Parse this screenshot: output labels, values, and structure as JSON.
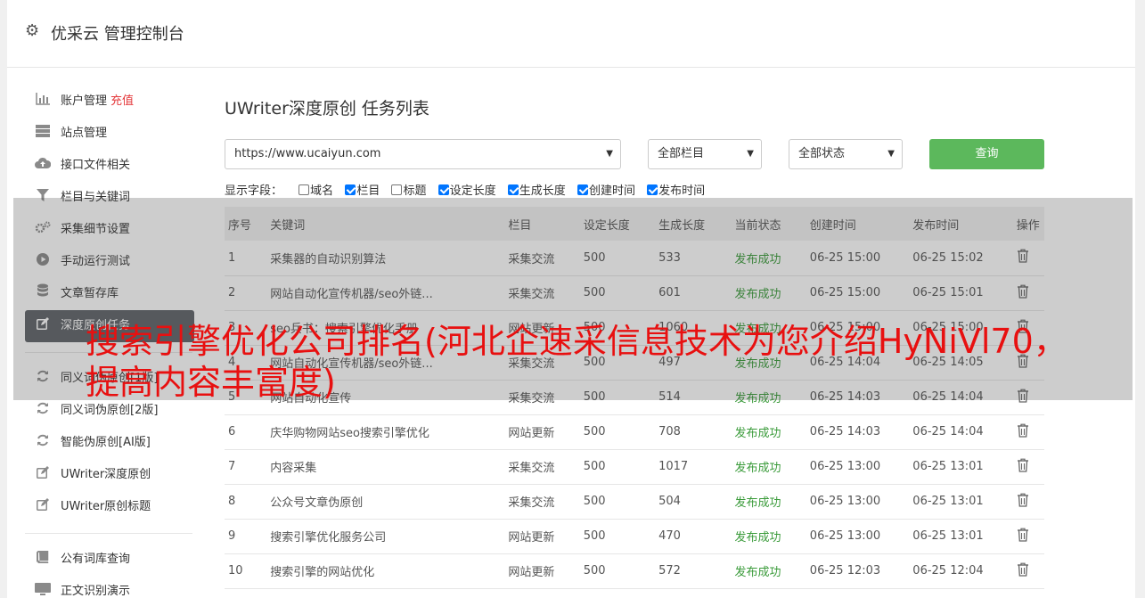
{
  "header": {
    "title": "优采云 管理控制台",
    "icon": "gear-icon"
  },
  "sidebar": {
    "items": [
      {
        "label": "账户管理",
        "badge": "充值",
        "icon": "bar-chart-icon"
      },
      {
        "label": "站点管理",
        "icon": "server-icon"
      },
      {
        "label": "接口文件相关",
        "icon": "cloud-upload-icon"
      },
      {
        "label": "栏目与关键词",
        "icon": "filter-icon"
      },
      {
        "label": "采集细节设置",
        "icon": "gears-icon"
      },
      {
        "label": "手动运行测试",
        "icon": "play-circle-icon"
      },
      {
        "label": "文章暂存库",
        "icon": "database-icon"
      },
      {
        "label": "深度原创任务",
        "icon": "edit-icon",
        "active": true
      },
      {
        "label": "同义词伪原创[1版]",
        "icon": "refresh-icon"
      },
      {
        "label": "同义词伪原创[2版]",
        "icon": "refresh-icon"
      },
      {
        "label": "智能伪原创[AI版]",
        "icon": "refresh-icon"
      },
      {
        "label": "UWriter深度原创",
        "icon": "edit-icon"
      },
      {
        "label": "UWriter原创标题",
        "icon": "edit-icon"
      },
      {
        "label": "公有词库查询",
        "icon": "book-icon"
      },
      {
        "label": "正文识别演示",
        "icon": "monitor-icon"
      }
    ]
  },
  "main": {
    "title": "UWriter深度原创 任务列表",
    "site_select": "https://www.ucaiyun.com",
    "column_select": "全部栏目",
    "status_select": "全部状态",
    "query_button": "查询",
    "fields_label": "显示字段：",
    "fields": [
      {
        "label": "域名",
        "checked": false
      },
      {
        "label": "栏目",
        "checked": true
      },
      {
        "label": "标题",
        "checked": false
      },
      {
        "label": "设定长度",
        "checked": true
      },
      {
        "label": "生成长度",
        "checked": true
      },
      {
        "label": "创建时间",
        "checked": true
      },
      {
        "label": "发布时间",
        "checked": true
      }
    ],
    "table": {
      "headers": [
        "序号",
        "关键词",
        "栏目",
        "设定长度",
        "生成长度",
        "当前状态",
        "创建时间",
        "发布时间",
        "操作"
      ],
      "rows": [
        [
          "1",
          "采集器的自动识别算法",
          "采集交流",
          "500",
          "533",
          "发布成功",
          "06-25 15:00",
          "06-25 15:02"
        ],
        [
          "2",
          "网站自动化宣传机器/seo外链...",
          "采集交流",
          "500",
          "601",
          "发布成功",
          "06-25 15:00",
          "06-25 15:01"
        ],
        [
          "3",
          "seo兵书：搜索引擎优化手册",
          "网站更新",
          "500",
          "1060",
          "发布成功",
          "06-25 15:00",
          "06-25 15:00"
        ],
        [
          "4",
          "网站自动化宣传机器/seo外链...",
          "采集交流",
          "500",
          "497",
          "发布成功",
          "06-25 14:04",
          "06-25 14:05"
        ],
        [
          "5",
          "网站自动化宣传",
          "采集交流",
          "500",
          "514",
          "发布成功",
          "06-25 14:03",
          "06-25 14:04"
        ],
        [
          "6",
          "庆华购物网站seo搜索引擎优化",
          "网站更新",
          "500",
          "708",
          "发布成功",
          "06-25 14:03",
          "06-25 14:04"
        ],
        [
          "7",
          "内容采集",
          "采集交流",
          "500",
          "1017",
          "发布成功",
          "06-25 13:00",
          "06-25 13:01"
        ],
        [
          "8",
          "公众号文章伪原创",
          "采集交流",
          "500",
          "504",
          "发布成功",
          "06-25 13:00",
          "06-25 13:01"
        ],
        [
          "9",
          "搜索引擎优化服务公司",
          "网站更新",
          "500",
          "470",
          "发布成功",
          "06-25 13:00",
          "06-25 13:01"
        ],
        [
          "10",
          "搜索引擎的网站优化",
          "网站更新",
          "500",
          "572",
          "发布成功",
          "06-25 12:03",
          "06-25 12:04"
        ]
      ]
    }
  },
  "watermark": "搜索引擎优化公司排名(河北企速采信息技术为您介绍HyNiVl70，提高内容丰富度)",
  "colors": {
    "accent": "#5cb85c",
    "danger": "#e4393c",
    "active_nav": "#5f6368",
    "success_text": "#3a9b3a"
  }
}
